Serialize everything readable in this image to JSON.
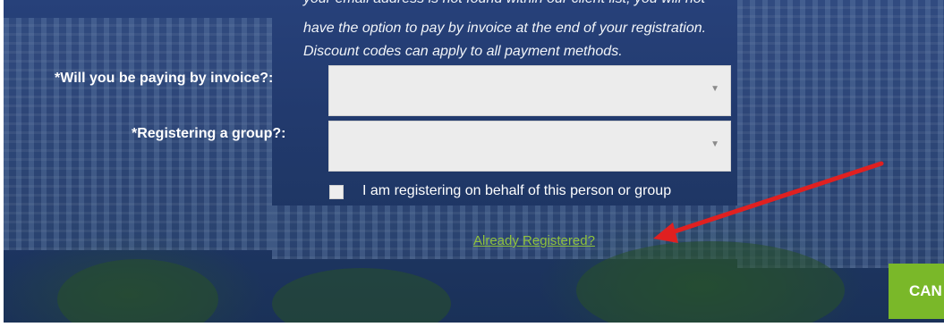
{
  "info": {
    "line0": "your email address is not found within our client list, you will not",
    "line1": "have the option to pay by invoice at the end of your registration.",
    "line2": "Discount codes can apply to all payment methods."
  },
  "fields": {
    "invoice_label": "*Will you be paying by invoice?:",
    "group_label": "*Registering a group?:",
    "invoice_value": "",
    "group_value": ""
  },
  "checkbox": {
    "label": "I am registering on behalf of this person or group",
    "checked": false
  },
  "links": {
    "already_registered": "Already Registered?"
  },
  "buttons": {
    "cancel_label": "CAN"
  },
  "icons": {
    "select_caret": "▼",
    "annotation_arrow": "red-arrow-icon"
  },
  "colors": {
    "link": "#8fc23c",
    "cancel_button": "#7ab829",
    "annotation": "#e02020"
  }
}
